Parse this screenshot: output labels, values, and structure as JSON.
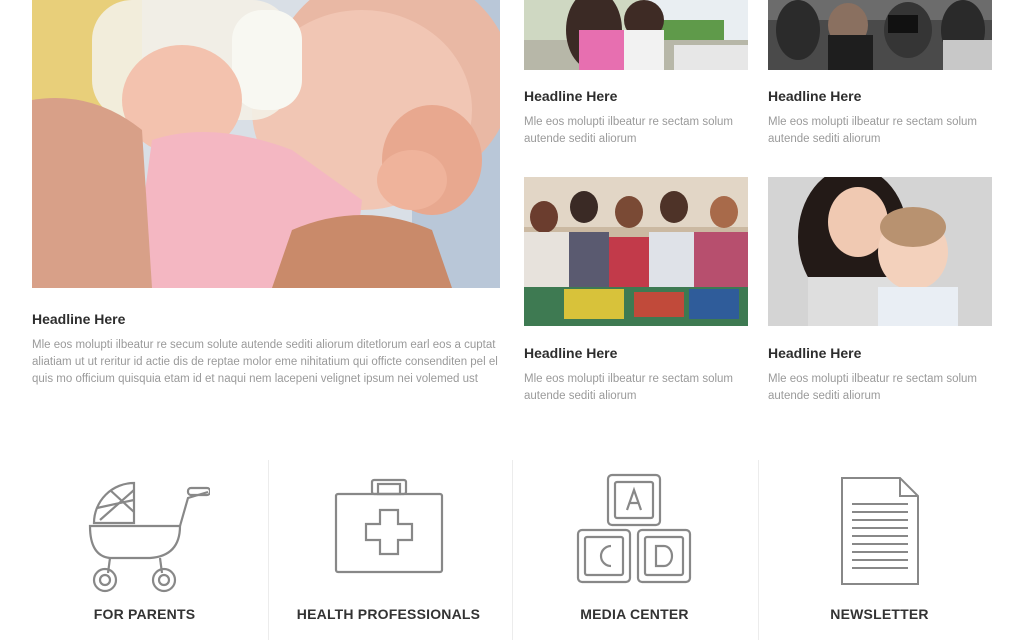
{
  "featured": {
    "headline": "Headline Here",
    "text": "Mle eos molupti ilbeatur re secum solute autende sediti aliorum ditetlorum earl eos a cuptat aliatiam ut ut reritur id actie dis de reptae molor eme nihitatium qui officte consenditen pel el quis mo officium quisquia etam id et naqui nem lacepeni velignet ipsum nei volemed ust"
  },
  "articles": [
    {
      "headline": "Headline Here",
      "text": "Mle eos molupti ilbeatur re sectam solum autende sediti aliorum"
    },
    {
      "headline": "Headline Here",
      "text": "Mle eos molupti ilbeatur re sectam solum autende sediti aliorum"
    },
    {
      "headline": "Headline Here",
      "text": "Mle eos molupti ilbeatur re sectam solum autende sediti aliorum"
    },
    {
      "headline": "Headline Here",
      "text": "Mle eos molupti ilbeatur re sectam solum autende sediti aliorum"
    }
  ],
  "features": [
    {
      "label": "FOR PARENTS",
      "icon": "stroller-icon"
    },
    {
      "label": "HEALTH PROFESSIONALS",
      "icon": "first-aid-kit-icon"
    },
    {
      "label": "MEDIA CENTER",
      "icon": "toy-blocks-icon"
    },
    {
      "label": "NEWSLETTER",
      "icon": "document-icon"
    }
  ]
}
